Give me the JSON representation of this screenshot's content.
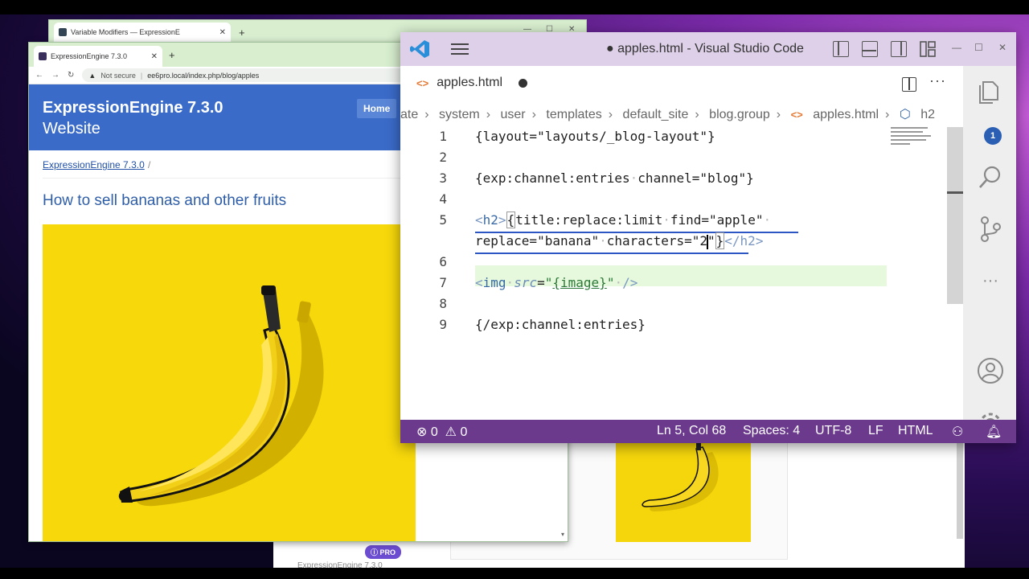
{
  "back_browser": {
    "tab_title": "Variable Modifiers — ExpressionE",
    "pro_badge": "PRO",
    "footer_text": "ExpressionEngine 7.3.0"
  },
  "browser": {
    "tab_title": "ExpressionEngine 7.3.0",
    "security": "Not secure",
    "url": "ee6pro.local/index.php/blog/apples",
    "site_title": "ExpressionEngine 7.3.0",
    "site_subtitle": "Website",
    "home_label": "Home",
    "breadcrumb": "ExpressionEngine 7.3.0",
    "breadcrumb_sep": "/",
    "post_title": "How to sell bananas and other fruits"
  },
  "vscode": {
    "window_title": "● apples.html - Visual Studio Code",
    "tab_label": "apples.html",
    "breadcrumbs": [
      "ate",
      "system",
      "user",
      "templates",
      "default_site",
      "blog.group",
      "apples.html",
      "h2"
    ],
    "lines": [
      "1",
      "2",
      "3",
      "4",
      "5",
      "",
      "6",
      "7",
      "8",
      "9"
    ],
    "code": {
      "l1": "{layout=\"layouts/_blog-layout\"}",
      "l3a": "{exp:channel:entries",
      "l3b": "channel=\"blog\"}",
      "l5_title": "title:replace:limit",
      "l5_find": "find=\"apple\"",
      "l5b_replace": "replace=\"banana\"",
      "l5b_chars": "characters=\"2",
      "l7_src_val": "{image}",
      "l9": "{/exp:channel:entries}"
    },
    "scm_badge": "1",
    "status": {
      "errors": "0",
      "warnings": "0",
      "position": "Ln 5, Col 68",
      "spaces": "Spaces: 4",
      "encoding": "UTF-8",
      "eol": "LF",
      "language": "HTML"
    }
  }
}
